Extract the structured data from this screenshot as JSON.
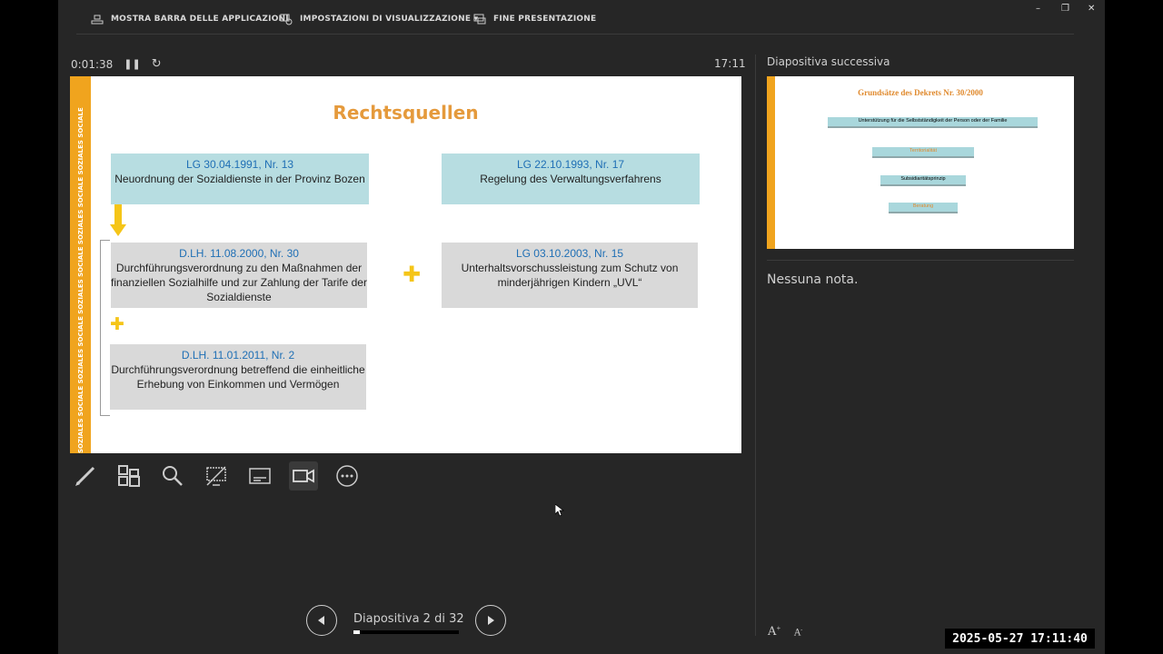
{
  "topbar": {
    "taskbar_label": "MOSTRA BARRA DELLE APPLICAZIONI",
    "display_settings_label": "IMPOSTAZIONI DI VISUALIZZAZIONE ▾",
    "end_show_label": "FINE PRESENTAZIONE"
  },
  "window_controls": {
    "minimize": "–",
    "restore": "❐",
    "close": "✕"
  },
  "presenter": {
    "elapsed": "0:01:38",
    "clock": "17:11"
  },
  "slide": {
    "stripe_text": "SOZIALES SOCIALE SOZIALES SOCIALE SOZIALES SOCIALE SOZIALES SOCIALE SOZIALES SOCIALE SOZIALES SOCIALE SOZIALES SOCIALE",
    "title": "Rechtsquellen",
    "boxes": [
      {
        "header": "LG 30.04.1991, Nr. 13",
        "body": "Neuordnung der Sozialdienste in der Provinz Bozen"
      },
      {
        "header": "LG 22.10.1993, Nr. 17",
        "body": "Regelung des Verwaltungsverfahrens"
      },
      {
        "header": "D.LH. 11.08.2000, Nr. 30",
        "body": "Durchführungsverordnung zu den Maßnahmen der finanziellen Sozialhilfe und zur Zahlung der Tarife der Sozialdienste"
      },
      {
        "header": "LG 03.10.2003, Nr. 15",
        "body": "Unterhaltsvorschussleistung zum Schutz von minderjährigen Kindern „UVL“"
      },
      {
        "header": "D.LH. 11.01.2011, Nr. 2",
        "body": "Durchführungsverordnung betreffend die einheitliche Erhebung von Einkommen und Vermögen"
      }
    ]
  },
  "next_slide": {
    "label": "Diapositiva successiva",
    "title": "Grundsätze des Dekrets Nr. 30/2000",
    "bars": [
      "Unterstützung für die Selbstständigkeit der Person oder der Familie",
      "Territorialität",
      "Subsidiaritätsprinzip",
      "Beratung"
    ]
  },
  "notes": {
    "text": "Nessuna nota."
  },
  "navigation": {
    "label": "Diapositiva 2 di 32",
    "progress": 0.06
  },
  "timestamp": "2025-05-27  17:11:40",
  "colors": {
    "accent": "#f0a41e",
    "teal_box": "#b7dde1",
    "gray_box": "#d9d9d9",
    "header_blue": "#1f6fb5",
    "title_orange": "#e59a3c"
  }
}
